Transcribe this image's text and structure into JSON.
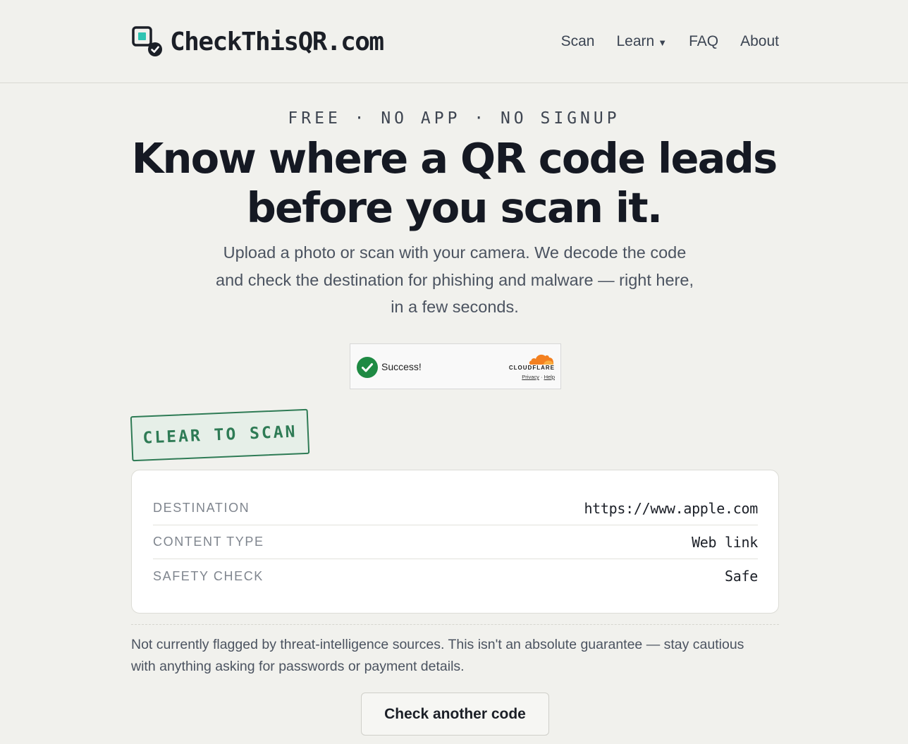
{
  "header": {
    "logo_text": "CheckThisQR.com",
    "logo_icon": "qr-check-icon",
    "nav": [
      {
        "label": "Scan"
      },
      {
        "label": "Learn",
        "has_dropdown": true
      },
      {
        "label": "FAQ"
      },
      {
        "label": "About"
      }
    ]
  },
  "hero": {
    "eyebrow": "FREE · NO APP · NO SIGNUP",
    "headline_line1": "Know where a QR code leads",
    "headline_line2": "before you scan it.",
    "subhead": "Upload a photo or scan with your camera. We decode the code and check the destination for phishing and malware — right here, in a few seconds."
  },
  "captcha": {
    "status": "Success!",
    "provider": "CLOUDFLARE",
    "privacy_link": "Privacy",
    "separator": "·",
    "help_link": "Help"
  },
  "result": {
    "stamp": "CLEAR TO SCAN",
    "rows": [
      {
        "label": "DESTINATION",
        "value": "https://www.apple.com"
      },
      {
        "label": "CONTENT TYPE",
        "value": "Web link"
      },
      {
        "label": "SAFETY CHECK",
        "value": "Safe"
      }
    ],
    "note": "Not currently flagged by threat-intelligence sources. This isn't an absolute guarantee — stay cautious with anything asking for passwords or payment details.",
    "action_label": "Check another code"
  },
  "colors": {
    "background": "#f1f1ed",
    "safe_green": "#2e7b55",
    "captcha_success": "#1e8a43",
    "cloudflare_orange": "#f38020"
  }
}
